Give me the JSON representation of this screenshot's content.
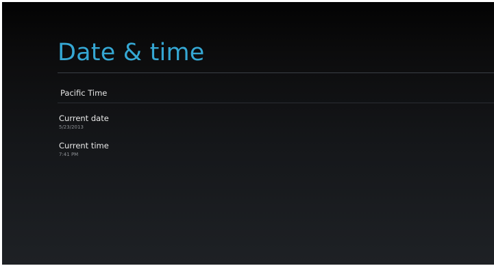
{
  "page": {
    "title": "Date & time",
    "accent_color": "#35a7d3"
  },
  "timezone": {
    "label": "Pacific Time"
  },
  "settings": [
    {
      "label": "Current date",
      "value": "5/23/2013"
    },
    {
      "label": "Current time",
      "value": "7:41 PM"
    }
  ]
}
